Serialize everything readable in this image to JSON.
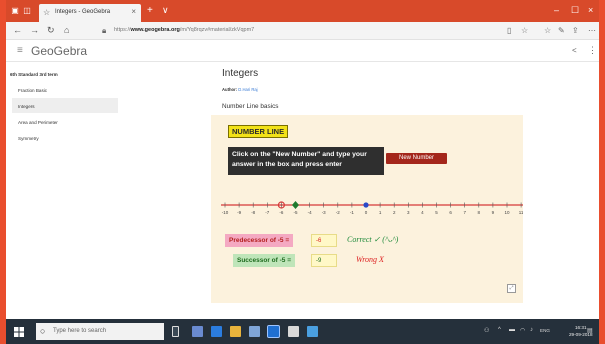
{
  "browser": {
    "tab_title": "Integers - GeoGebra",
    "url_prefix": "https://",
    "url_domain": "www.geogebra.org",
    "url_path": "/m/Yq8rqzv#material/zkVqpm7",
    "tab_close": "×",
    "new_tab": "+",
    "tab_drop": "∨",
    "win_min": "–",
    "win_max": "☐",
    "win_close": "×",
    "back": "←",
    "forward": "→",
    "refresh": "↻",
    "home": "⌂"
  },
  "geogebra": {
    "logo": "GeoGebra"
  },
  "sidebar": {
    "items": [
      {
        "label": "6th Standard 3rd term"
      },
      {
        "label": "Fraction Basic"
      },
      {
        "label": "Integers"
      },
      {
        "label": "Area and Perimeter"
      },
      {
        "label": "Symmetry"
      }
    ]
  },
  "main": {
    "title": "Integers",
    "author_label": "Author:",
    "author_name": "D.Hari Raj",
    "section_title": "Number Line basics"
  },
  "applet": {
    "number_line_label": "NUMBER LINE",
    "instruction": "Click on the \"New Number\" and type your answer in the box and press enter",
    "new_number_button": "New Number",
    "ticks": [
      -10,
      -9,
      -8,
      -7,
      -6,
      -5,
      -4,
      -3,
      -2,
      -1,
      0,
      1,
      2,
      3,
      4,
      5,
      6,
      7,
      8,
      9,
      10,
      11
    ],
    "point_red": -6,
    "point_green": -5,
    "point_blue": 0,
    "predecessor_label": "Predecessor of -5 =",
    "predecessor_answer": "-6",
    "feedback_correct": "Correct ✓ (^ᴗ^)",
    "successor_label": "Successor of -5 =",
    "successor_answer": "-9",
    "feedback_wrong": "Wrong X"
  },
  "taskbar": {
    "search_placeholder": "Type here to search",
    "tray_text": "ENG",
    "time": "16:31",
    "date": "29-09-2018"
  },
  "colors": {
    "desktop_bg": "#e94e2e",
    "titlebar": "#d84a2a",
    "applet_bg": "#fcf2dd",
    "new_number_btn": "#a4271b",
    "taskbar": "#25303b"
  }
}
